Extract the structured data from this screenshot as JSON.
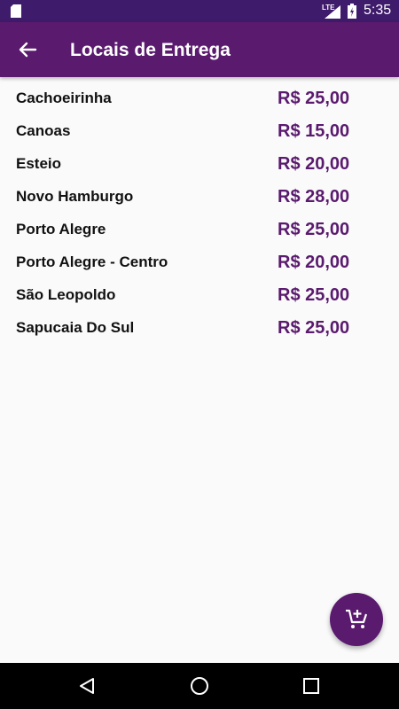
{
  "status_bar": {
    "network_label": "LTE",
    "time": "5:35",
    "icons": [
      "sd-card-icon",
      "signal-icon",
      "battery-icon"
    ]
  },
  "app_bar": {
    "title": "Locais de Entrega",
    "back_icon": "arrow-back-icon"
  },
  "locations": [
    {
      "name": "Cachoeirinha",
      "price": "R$ 25,00"
    },
    {
      "name": "Canoas",
      "price": "R$ 15,00"
    },
    {
      "name": "Esteio",
      "price": "R$ 20,00"
    },
    {
      "name": "Novo Hamburgo",
      "price": "R$ 28,00"
    },
    {
      "name": "Porto Alegre",
      "price": "R$ 25,00"
    },
    {
      "name": "Porto Alegre - Centro",
      "price": "R$ 20,00"
    },
    {
      "name": "São Leopoldo",
      "price": "R$ 25,00"
    },
    {
      "name": "Sapucaia Do Sul",
      "price": "R$ 25,00"
    }
  ],
  "fab": {
    "icon": "add-to-cart-icon"
  },
  "nav_bar": {
    "icons": [
      "back-triangle-icon",
      "home-circle-icon",
      "recents-square-icon"
    ]
  },
  "colors": {
    "primary": "#5a1a6e",
    "status_bar": "#3f1b6b",
    "background": "#fafafa",
    "text": "#111111"
  }
}
